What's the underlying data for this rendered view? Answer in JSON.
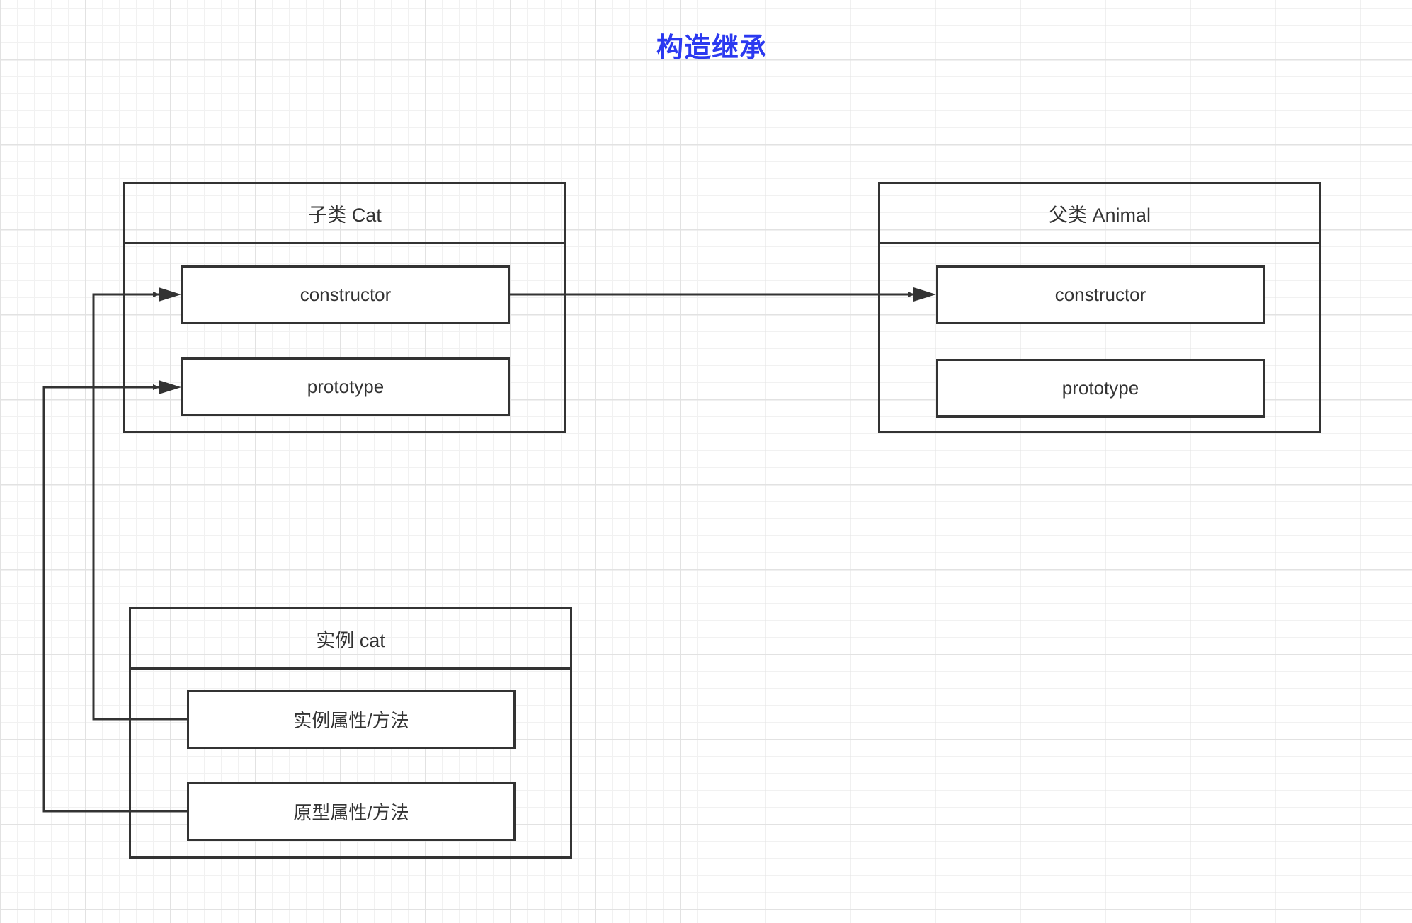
{
  "title": "构造继承",
  "colors": {
    "title": "#2b39f0",
    "line": "#333333",
    "grid": "#e2e2e2"
  },
  "subclass": {
    "label": "子类 Cat",
    "fields": [
      "constructor",
      "prototype"
    ]
  },
  "parent": {
    "label": "父类 Animal",
    "fields": [
      "constructor",
      "prototype"
    ]
  },
  "instance": {
    "label": "实例 cat",
    "fields": [
      "实例属性/方法",
      "原型属性/方法"
    ]
  }
}
